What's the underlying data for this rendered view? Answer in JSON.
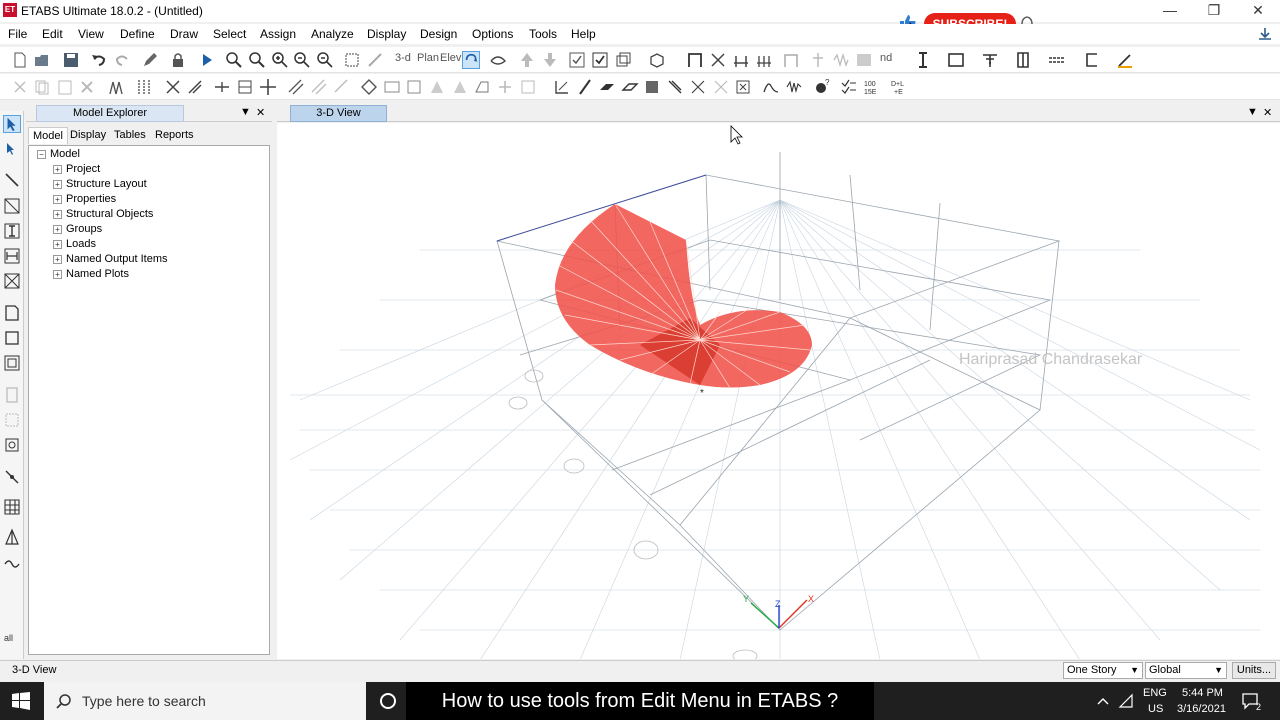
{
  "window": {
    "title": "ETABS Ultimate 18.0.2 - (Untitled)",
    "app_icon_text": "ET",
    "minimize": "—",
    "maximize": "❐",
    "close": "✕"
  },
  "overlay": {
    "subscribe_label": "SUBSCRIBE!",
    "watermark": "Hariprasad Chandrasekar",
    "caption": "How to use tools from Edit Menu in ETABS ?"
  },
  "menu": [
    "File",
    "Edit",
    "View",
    "Define",
    "Draw",
    "Select",
    "Assign",
    "Analyze",
    "Display",
    "Design",
    "Options",
    "Tools",
    "Help"
  ],
  "toolbar": {
    "view_3d_label": "3-d",
    "plan_label": "Plan",
    "elev_label": "Elev",
    "nd_label": "nd"
  },
  "explorer": {
    "title": "Model Explorer",
    "pin": "▼",
    "close": "✕",
    "tabs": [
      "Model",
      "Display",
      "Tables",
      "Reports"
    ],
    "active_tab": "Model",
    "root": "Model",
    "items": [
      "Project",
      "Structure Layout",
      "Properties",
      "Structural Objects",
      "Groups",
      "Loads",
      "Named Output Items",
      "Named Plots"
    ]
  },
  "view": {
    "tab_label": "3-D View",
    "pin": "▼",
    "close": "✕",
    "axis_x": "X",
    "axis_y": "Y",
    "axis_z": "Z"
  },
  "status": {
    "text": "3-D View",
    "story": "One Story",
    "coord": "Global",
    "units": "Units..."
  },
  "taskbar": {
    "search_placeholder": "Type here to search",
    "lang_top": "ENG",
    "lang_bottom": "US",
    "time": "5:44 PM",
    "date": "3/16/2021",
    "notification_count": "2"
  },
  "colors": {
    "accent": "#2d7dd2",
    "subscribe": "#e62117",
    "stair": "#f0524a",
    "grid": "#b8c8d8"
  }
}
